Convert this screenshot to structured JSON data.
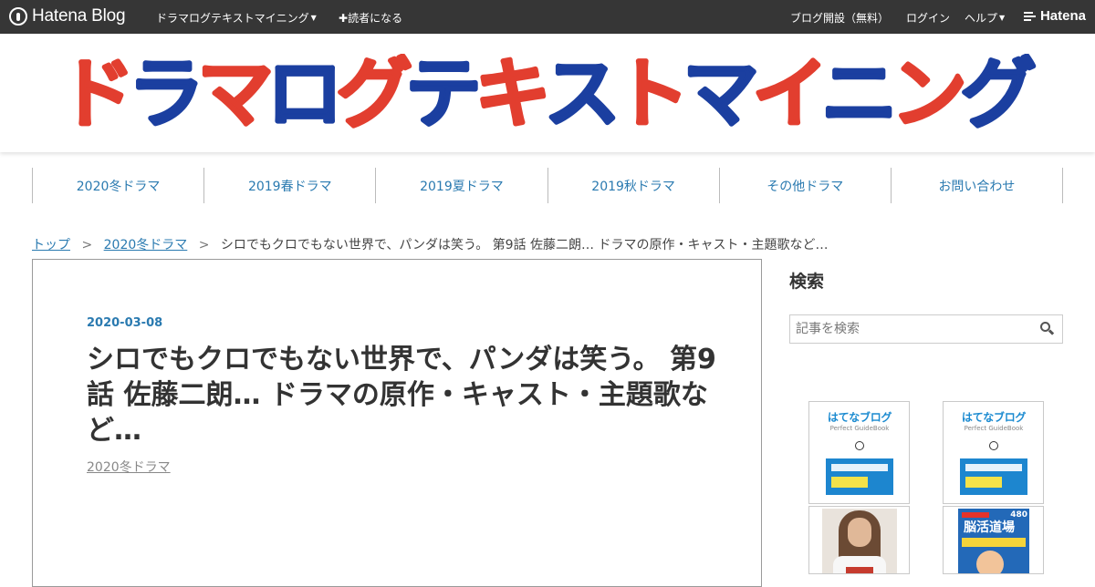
{
  "topbar": {
    "logo_text": "Hatena Blog",
    "blog_menu": "ドラマログテキストマイニング",
    "subscribe": "読者になる",
    "create_blog": "ブログ開設（無料）",
    "login": "ログイン",
    "help": "ヘルプ",
    "brand": "Hatena"
  },
  "header": {
    "banner_title": "ドラマログテキストマイニング"
  },
  "nav": {
    "categories": [
      "2020冬ドラマ",
      "2019春ドラマ",
      "2019夏ドラマ",
      "2019秋ドラマ",
      "その他ドラマ",
      "お問い合わせ"
    ]
  },
  "breadcrumb": {
    "home": "トップ",
    "sep": ">",
    "category": "2020冬ドラマ",
    "current": "シロでもクロでもない世界で、パンダは笑う。 第9話 佐藤二朗… ドラマの原作・キャスト・主題歌など…"
  },
  "article": {
    "date": "2020-03-08",
    "title": "シロでもクロでもない世界で、パンダは笑う。 第9話 佐藤二朗… ドラマの原作・キャスト・主題歌など…",
    "category": "2020冬ドラマ"
  },
  "sidebar": {
    "search_title": "検索",
    "search_placeholder": "記事を検索",
    "ads": [
      {
        "title": "はてなブログ",
        "subtitle": "Perfect GuideBook"
      },
      {
        "title": "はてなブログ",
        "subtitle": "Perfect GuideBook"
      },
      {
        "title": "",
        "subtitle": ""
      },
      {
        "title": "脳活道場",
        "subtitle": "480"
      }
    ]
  },
  "colors": {
    "topbar_bg": "#363636",
    "link_blue": "#2a7ab0",
    "banner_red": "#e23e2f",
    "banner_blue": "#1b3fa0"
  }
}
